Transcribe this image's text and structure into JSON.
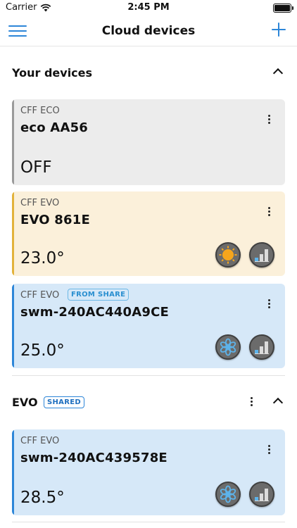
{
  "status_bar": {
    "carrier": "Carrier",
    "time": "2:45 PM"
  },
  "nav": {
    "title": "Cloud devices"
  },
  "sections": [
    {
      "title": "Your devices",
      "devices": [
        {
          "type": "CFF ECO",
          "name": "eco AA56",
          "value": "OFF",
          "color": "gray"
        },
        {
          "type": "CFF EVO",
          "name": "EVO 861E",
          "value": "23.0°",
          "color": "yellow",
          "mode_icon": "sun-icon",
          "fan_icon": "fan-speed-icon"
        },
        {
          "type": "CFF EVO",
          "badge": "FROM SHARE",
          "name": "swm-240AC440A9CE",
          "value": "25.0°",
          "color": "blue",
          "mode_icon": "snowflake-icon",
          "fan_icon": "fan-speed-icon"
        }
      ]
    },
    {
      "title": "EVO",
      "badge": "SHARED",
      "devices": [
        {
          "type": "CFF EVO",
          "name": "swm-240AC439578E",
          "value": "28.5°",
          "color": "blue",
          "mode_icon": "snowflake-icon",
          "fan_icon": "fan-speed-icon"
        }
      ]
    }
  ],
  "colors": {
    "accent": "#2d86d8",
    "heat": "#f5a51c",
    "cool": "#5db3ea"
  }
}
